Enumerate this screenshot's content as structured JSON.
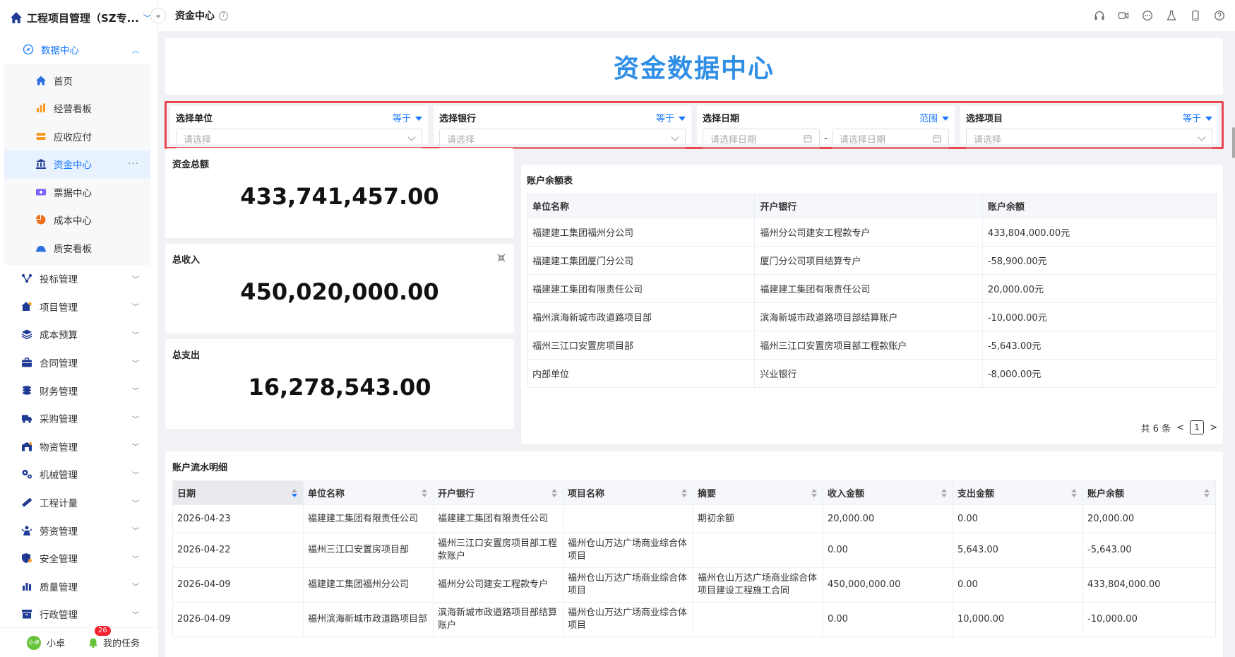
{
  "app": {
    "title": "工程项目管理（SZ专..."
  },
  "topbar": {
    "page_title": "资金中心",
    "help": "?"
  },
  "sidebar": {
    "open_group": "数据中心",
    "sub_items": [
      {
        "label": "首页"
      },
      {
        "label": "经营看板"
      },
      {
        "label": "应收应付"
      },
      {
        "label": "资金中心",
        "active": true,
        "more": "···"
      },
      {
        "label": "票据中心"
      },
      {
        "label": "成本中心"
      },
      {
        "label": "质安看板"
      }
    ],
    "groups": [
      {
        "label": "投标管理"
      },
      {
        "label": "项目管理"
      },
      {
        "label": "成本预算"
      },
      {
        "label": "合同管理"
      },
      {
        "label": "财务管理"
      },
      {
        "label": "采购管理"
      },
      {
        "label": "物资管理"
      },
      {
        "label": "机械管理"
      },
      {
        "label": "工程计量"
      },
      {
        "label": "劳资管理"
      },
      {
        "label": "安全管理"
      },
      {
        "label": "质量管理"
      },
      {
        "label": "行政管理"
      }
    ],
    "user": {
      "avatar": "小卓",
      "name": "小卓"
    },
    "tasks": {
      "label": "我的任务",
      "count": "26"
    }
  },
  "hero": {
    "title": "资金数据中心"
  },
  "filters": {
    "unit": {
      "label": "选择单位",
      "op": "等于",
      "placeholder": "请选择"
    },
    "bank": {
      "label": "选择银行",
      "op": "等于",
      "placeholder": "请选择"
    },
    "date": {
      "label": "选择日期",
      "op": "范围",
      "start_placeholder": "请选择日期",
      "sep": "-",
      "end_placeholder": "请选择日期"
    },
    "project": {
      "label": "选择项目",
      "op": "等于",
      "placeholder": "请选择"
    }
  },
  "stats": {
    "total": {
      "label": "资金总额",
      "value": "433,741,457.00"
    },
    "income": {
      "label": "总收入",
      "value": "450,020,000.00"
    },
    "expense": {
      "label": "总支出",
      "value": "16,278,543.00"
    }
  },
  "account_table": {
    "title": "账户余额表",
    "columns": [
      "单位名称",
      "开户银行",
      "账户余额"
    ],
    "rows": [
      [
        "福建建工集团福州分公司",
        "福州分公司建安工程款专户",
        "433,804,000.00元"
      ],
      [
        "福建建工集团厦门分公司",
        "厦门分公司项目结算专户",
        "-58,900.00元"
      ],
      [
        "福建建工集团有限责任公司",
        "福建建工集团有限责任公司",
        "20,000.00元"
      ],
      [
        "福州滨海新城市政道路项目部",
        "滨海新城市政道路项目部结算账户",
        "-10,000.00元"
      ],
      [
        "福州三江口安置房项目部",
        "福州三江口安置房项目部工程款账户",
        "-5,643.00元"
      ],
      [
        "内部单位",
        "兴业银行",
        "-8,000.00元"
      ]
    ],
    "pager": {
      "total": "共 6 条",
      "page": "1",
      "prev": "<",
      "next": ">"
    }
  },
  "flow_table": {
    "title": "账户流水明细",
    "columns": [
      "日期",
      "单位名称",
      "开户银行",
      "项目名称",
      "摘要",
      "收入金额",
      "支出金额",
      "账户余额"
    ],
    "rows": [
      [
        "2026-04-23",
        "福建建工集团有限责任公司",
        "福建建工集团有限责任公司",
        "",
        "期初余额",
        "20,000.00",
        "0.00",
        "20,000.00"
      ],
      [
        "2026-04-22",
        "福州三江口安置房项目部",
        "福州三江口安置房项目部工程款账户",
        "福州仓山万达广场商业综合体项目",
        "",
        "0.00",
        "5,643.00",
        "-5,643.00"
      ],
      [
        "2026-04-09",
        "福建建工集团福州分公司",
        "福州分公司建安工程款专户",
        "福州仓山万达广场商业综合体项目",
        "福州仓山万达广场商业综合体项目建设工程施工合同",
        "450,000,000.00",
        "0.00",
        "433,804,000.00"
      ],
      [
        "2026-04-09",
        "福州滨海新城市政道路项目部",
        "滨海新城市政道路项目部结算账户",
        "福州仓山万达广场商业综合体项目",
        "",
        "0.00",
        "10,000.00",
        "-10,000.00"
      ]
    ]
  },
  "colors": {
    "accent": "#1677ff",
    "hero": "#2f8ee5",
    "highlight_border": "#e9464d"
  }
}
